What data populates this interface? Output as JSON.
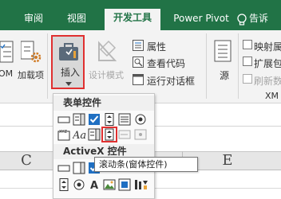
{
  "tabs": [
    {
      "label": "审阅",
      "active": false
    },
    {
      "label": "视图",
      "active": false
    },
    {
      "label": "开发工具",
      "active": true
    },
    {
      "label": "Power Pivot",
      "active": false
    }
  ],
  "tell_me": "告诉",
  "ribbon": {
    "com_addins_label": "OM",
    "addins_label": "加载项",
    "insert_label": "插入",
    "design_mode_label": "设计模式",
    "properties_label": "属性",
    "view_code_label": "查看代码",
    "run_dialog_label": "运行对话框",
    "source_label": "源",
    "map_props_label": "映射属",
    "expansion_pack_label": "扩展包",
    "refresh_data_label": "刷新数",
    "xml_group_label": "XM"
  },
  "dropdown": {
    "form_controls_header": "表单控件",
    "activex_header": "ActiveX 控件"
  },
  "tooltip": "滚动条(窗体控件)",
  "columns": [
    "C",
    "E"
  ],
  "colors": {
    "tab_bar": "#217346",
    "highlight": "#e03030",
    "checkbox_blue": "#1f6fc2"
  },
  "icons": {
    "tell_me": "lightbulb-icon",
    "addins": "gear-icon",
    "insert": "toolbox-icon",
    "design_mode": "ruler-triangle-icon",
    "properties": "properties-icon",
    "view_code": "code-icon",
    "run_dialog": "dialog-icon",
    "source": "xml-source-icon"
  }
}
